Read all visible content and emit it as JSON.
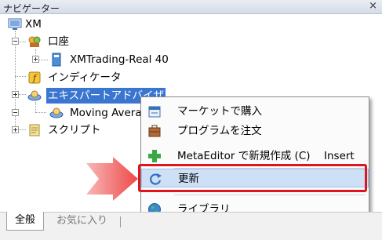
{
  "window": {
    "title": "ナビゲーター",
    "close": "×"
  },
  "tree": {
    "root": "XM",
    "accounts": "口座",
    "account_item": "XMTrading-Real 40",
    "indicators": "インディケータ",
    "experts": "エキスパートアドバイザ",
    "expert_item": "Moving Avera",
    "scripts": "スクリプト"
  },
  "context_menu": {
    "items": [
      {
        "label": "マーケットで購入",
        "icon": "market-icon"
      },
      {
        "label": "プログラムを注文",
        "icon": "briefcase-icon"
      },
      {
        "label": "MetaEditor で新規作成 (C)",
        "shortcut": "Insert",
        "icon": "plus-icon"
      },
      {
        "label": "更新",
        "icon": "refresh-icon"
      },
      {
        "label": "ライブラリ",
        "icon": "globe-icon"
      }
    ]
  },
  "tabs": {
    "general": "全般",
    "favorites": "お気に入り"
  },
  "colors": {
    "selection": "#3a76d0",
    "highlight": "#cde0f5",
    "annotation": "#e0141e"
  }
}
